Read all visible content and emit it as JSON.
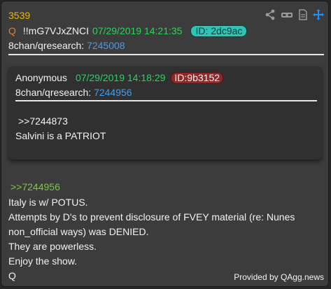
{
  "post": {
    "number": "3539",
    "icons": [
      "share-icon",
      "glasses-icon",
      "document-icon",
      "move-icon"
    ],
    "q_mark": "Q",
    "tripcode": "!!mG7VJxZNCI",
    "datetime": "07/29/2019 14:21:35",
    "id_badge": "ID: 2dc9ac",
    "board_label": "8chan/qresearch:",
    "board_post": "7245008"
  },
  "quoted": {
    "author": "Anonymous",
    "datetime": "07/29/2019 14:18:29",
    "id_badge": "ID:9b3152",
    "board_label": "8chan/qresearch:",
    "board_post": "7244956",
    "reply_ref": ">>7244873",
    "body": "Salvini is a PATRIOT"
  },
  "body": {
    "reply_ref": ">>7244956",
    "lines": [
      "Italy is w/ POTUS.",
      "Attempts by D's to prevent disclosure of FVEY material (re: Nunes",
      "non_official ways) was DENIED.",
      "They are powerless.",
      "Enjoy the show.",
      "Q"
    ]
  },
  "footer": "Provided by QAgg.news",
  "colors": {
    "post_number": "#f0b400",
    "date": "#2bd35c",
    "id_badge_bg": "#2ec4b6",
    "id_red_bg": "#8b2a2a",
    "link": "#4a9be8",
    "reply_green": "#7ec54a",
    "move_icon": "#1e90ff"
  }
}
